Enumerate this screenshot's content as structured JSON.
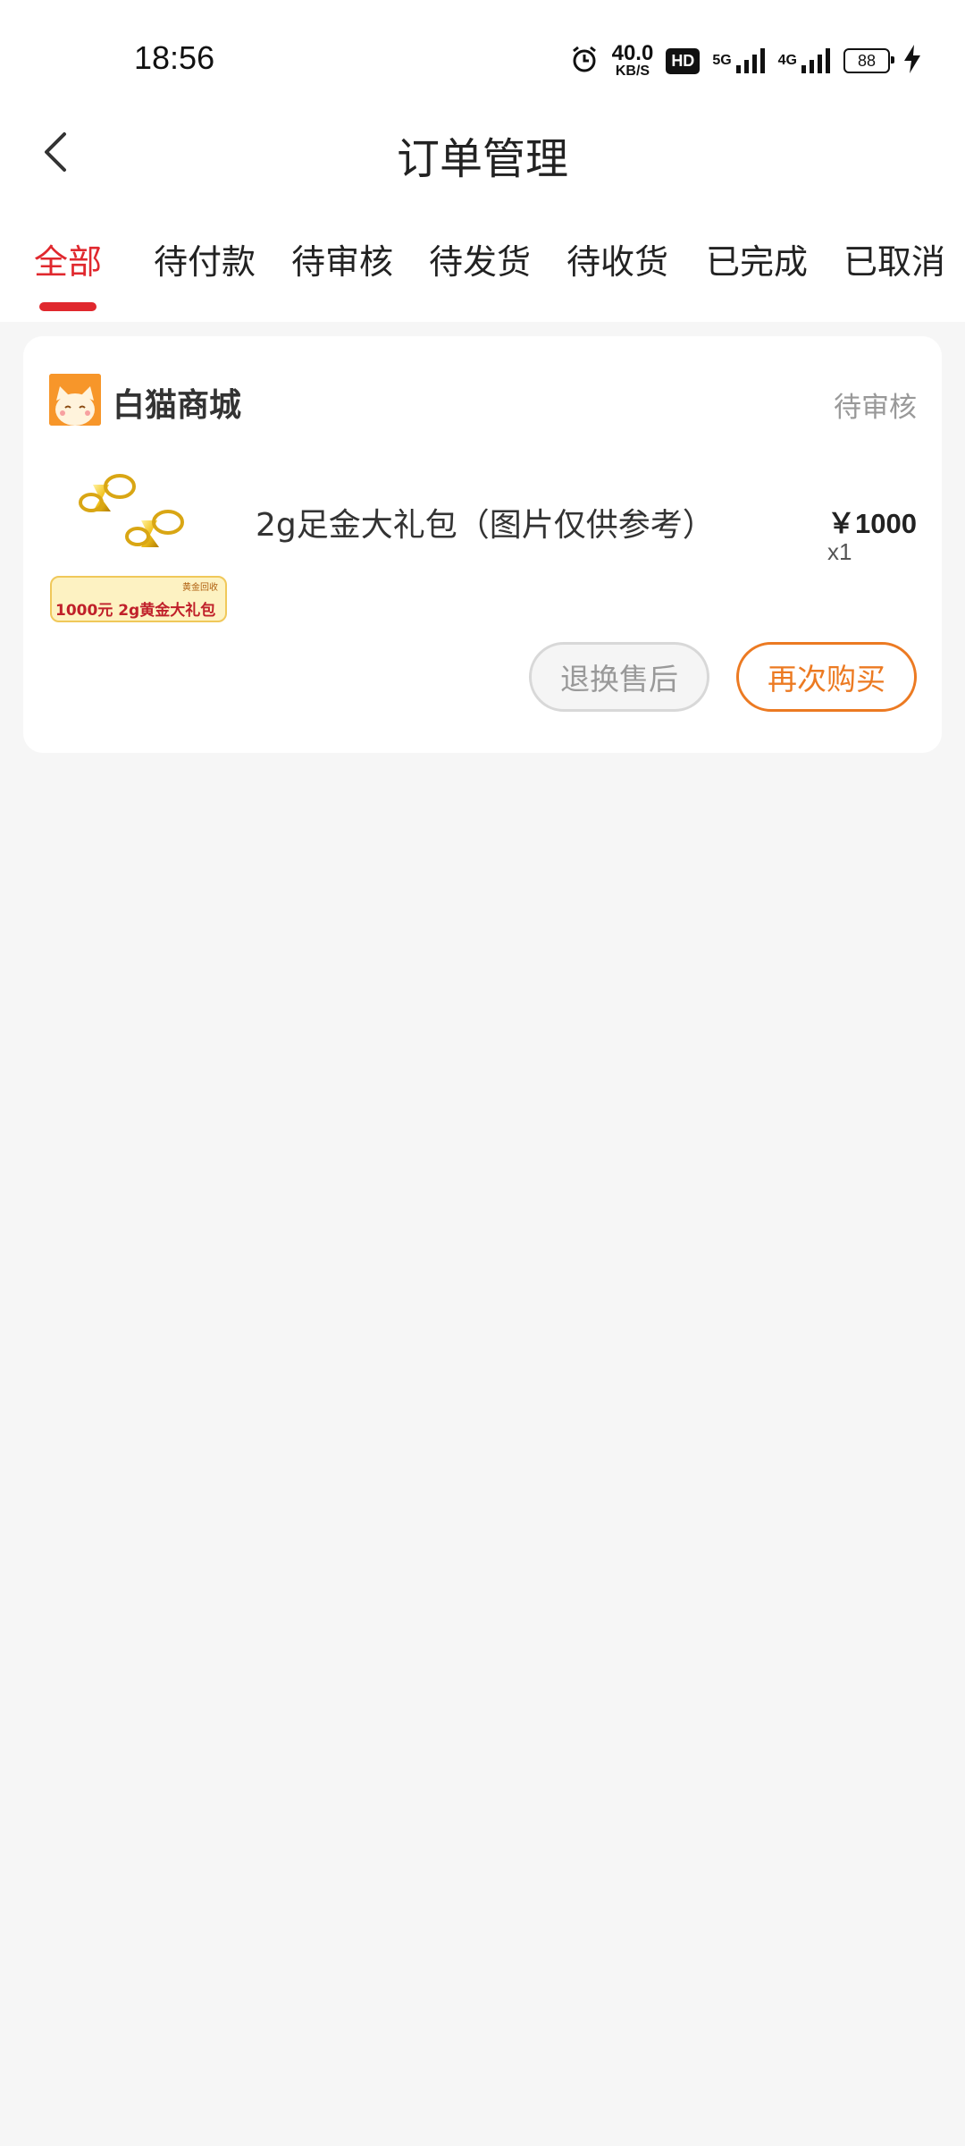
{
  "status_bar": {
    "time": "18:56",
    "net_speed_value": "40.0",
    "net_speed_unit": "KB/S",
    "hd_label": "HD",
    "sim1_label": "5G",
    "sim2_label": "4G",
    "battery_level": "88"
  },
  "header": {
    "title": "订单管理"
  },
  "tabs": [
    {
      "label": "全部",
      "active": true
    },
    {
      "label": "待付款"
    },
    {
      "label": "待审核"
    },
    {
      "label": "待发货"
    },
    {
      "label": "待收货"
    },
    {
      "label": "已完成"
    },
    {
      "label": "已取消"
    }
  ],
  "order": {
    "store_name": "白猫商城",
    "status": "待审核",
    "product": {
      "name": "2g足金大礼包（图片仅供参考）",
      "price": "￥1000",
      "quantity": "x1",
      "thumb_tag": "黄金回收",
      "thumb_text": "1000元  2g黄金大礼包"
    },
    "actions": {
      "after_sale": "退换售后",
      "rebuy": "再次购买"
    }
  },
  "colors": {
    "accent_red": "#e0282e",
    "accent_orange": "#ec7a22",
    "background": "#f6f6f6"
  }
}
